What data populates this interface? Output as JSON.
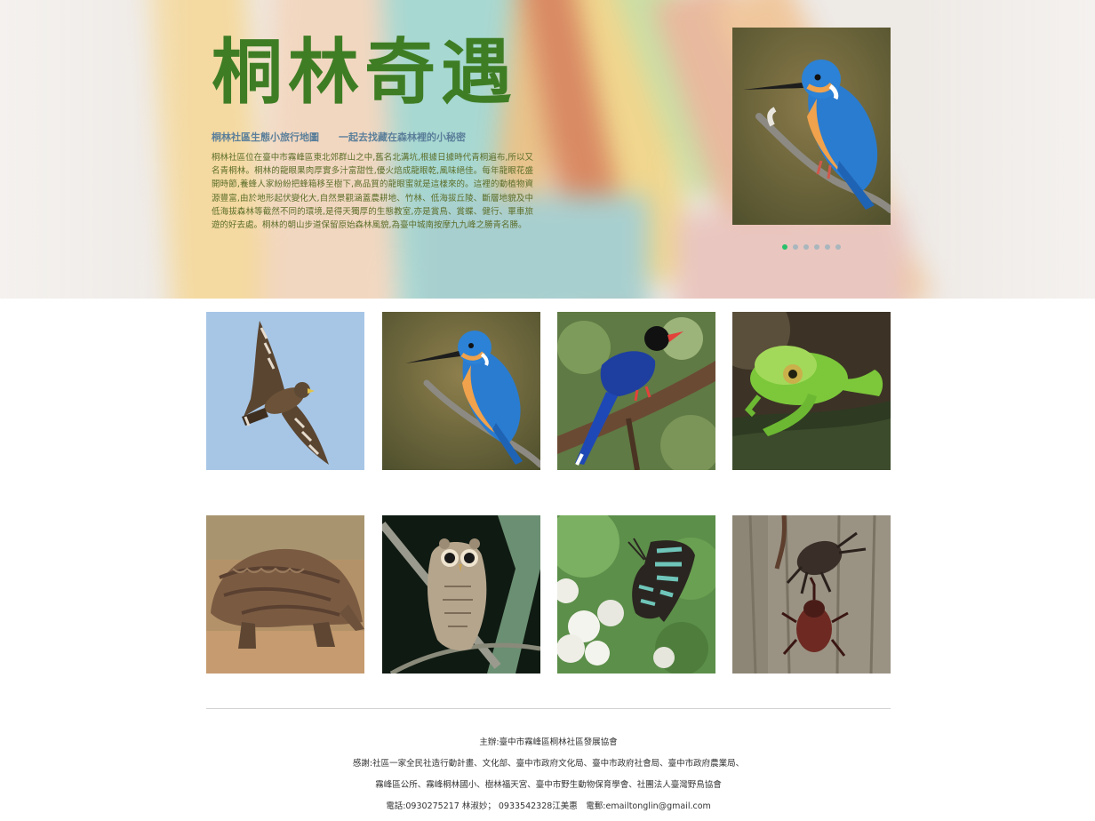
{
  "hero": {
    "title": "桐林奇遇",
    "subtitle": "桐林社區生態小旅行地圖　　一起去找藏在森林裡的小秘密",
    "description": "桐林社區位在臺中市霧峰區東北郊群山之中,舊名北溝坑,根據日據時代青桐遍布,所以又名青桐林。桐林的龍眼果肉厚實多汁富甜性,優火焙成龍眼乾,風味絕佳。每年龍眼花盛開時節,養蜂人家紛紛把蜂箱移至樹下,高品質的龍眼蜜就是這樣來的。這裡的動植物資源豐富,由於地形起伏變化大,自然景觀涵蓋農耕地、竹林、低海拔丘陵、斷層地貌及中低海拔森林等截然不同的環境,是得天獨厚的生態教室,亦是賞鳥、賞蝶、健行、單車旅遊的好去處。桐林的朝山步道保留原始森林風貌,為臺中城南按摩九九峰之勝青名勝。",
    "photo": "kingfisher",
    "carousel": {
      "count": 6,
      "active": 1
    },
    "colors": {
      "title": "#3f7d25",
      "subtitle": "#5b7f9a",
      "description": "#5c6e2a",
      "active_dot": "#27c16a"
    }
  },
  "gallery": {
    "row1": [
      "crested-serpent-eagle",
      "kingfisher",
      "taiwan-blue-magpie",
      "green-tree-frog"
    ],
    "row2": [
      "pangolin",
      "scops-owl",
      "swallowtail-butterfly",
      "rhinoceros-beetles"
    ]
  },
  "footer": {
    "host": "主辦:臺中市霧峰區桐林社區發展協會",
    "thanks_1": "感謝:社區一家全民社造行動計畫、文化部、臺中市政府文化局、臺中市政府社會局、臺中市政府農業局、",
    "thanks_2": "霧峰區公所、霧峰桐林國小、樹林福天宮、臺中市野生動物保育學會、社團法人臺灣野鳥協會",
    "contact": "電話:0930275217 林淑妙； 0933542328江美惠　電郵:emailtonglin@gmail.com"
  }
}
